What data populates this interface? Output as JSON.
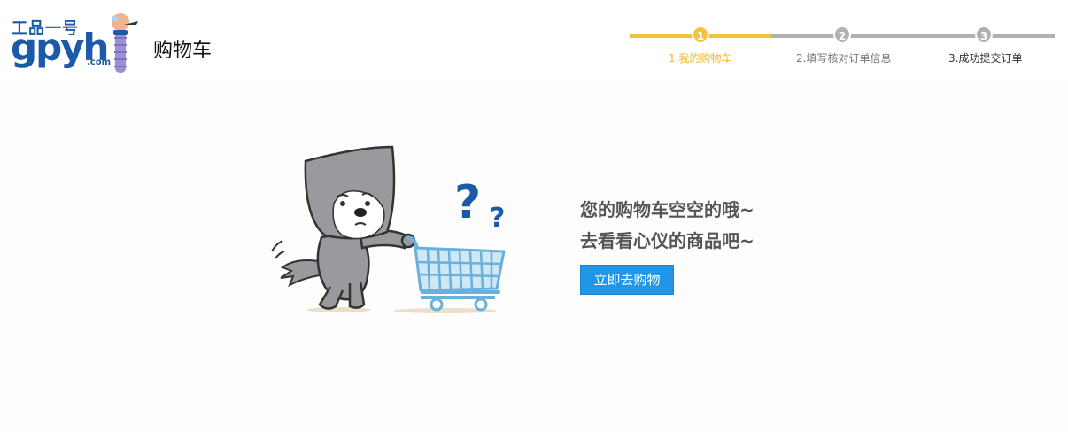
{
  "header": {
    "logo": {
      "top_text": "工品一号",
      "main_text": "gpyh",
      "domain_text": ".com"
    },
    "title": "购物车"
  },
  "steps": [
    {
      "number": "1",
      "label": "1.我的购物车",
      "state": "active"
    },
    {
      "number": "2",
      "label": "2.填写核对订单信息",
      "state": "pending"
    },
    {
      "number": "3",
      "label": "3.成功提交订单",
      "state": "pending"
    }
  ],
  "empty_cart": {
    "illustration": "sad-wolf-with-shopping-cart",
    "line1": "您的购物车空空的哦~",
    "line2": "去看看心仪的商品吧~",
    "button_label": "立即去购物"
  },
  "colors": {
    "brand_blue": "#1a5aa8",
    "step_active": "#f3c33e",
    "step_inactive": "#b1b1b1",
    "button_blue": "#2196e6",
    "question_mark": "#1a5aa8",
    "cart_blue": "#6ab0dc"
  }
}
